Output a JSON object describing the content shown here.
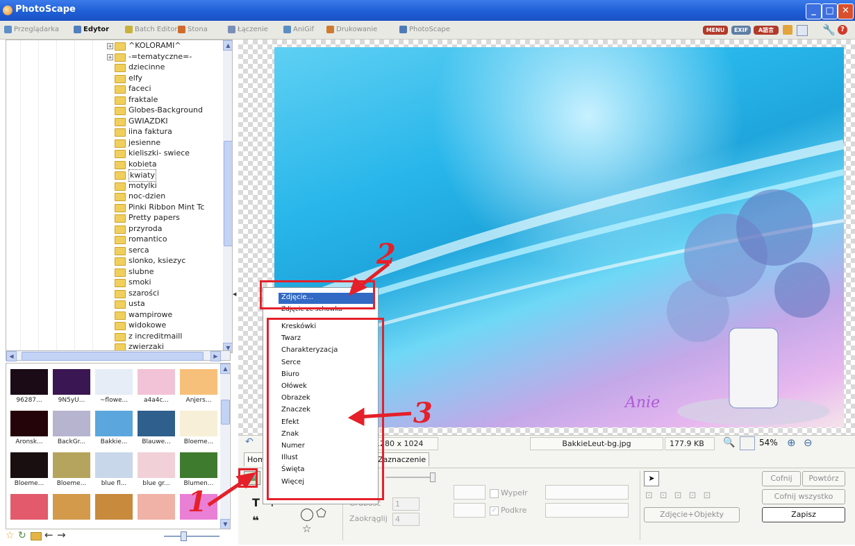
{
  "window": {
    "title": "PhotoScape"
  },
  "tabs": [
    {
      "label": "Przeglądarka",
      "active": false
    },
    {
      "label": "Edytor",
      "active": true
    },
    {
      "label": "Batch Editor",
      "active": false
    },
    {
      "label": "Stona",
      "active": false
    },
    {
      "label": "Łączenie",
      "active": false
    },
    {
      "label": "AniGif",
      "active": false
    },
    {
      "label": "Drukowanie",
      "active": false
    },
    {
      "label": "PhotoScape",
      "active": false
    }
  ],
  "toolbar_right": {
    "menu_label": "MENU",
    "exif_label": "EXIF",
    "lang_label": "A語言"
  },
  "folder_tree": {
    "items": [
      "^KOLORAMI^",
      "-=tematyczne=-",
      "dziecinne",
      "elfy",
      "faceci",
      "fraktale",
      "Globes-Background",
      "GWIAZDKI",
      "iina faktura",
      "jesienne",
      "kieliszki- swiece",
      "kobieta",
      "kwiaty",
      "motylki",
      "noc-dzien",
      "Pinki Ribbon Mint Tc",
      "Pretty papers",
      "przyroda",
      "romantico",
      "serca",
      "slonko, ksiezyc",
      "slubne",
      "smoki",
      "szarości",
      "usta",
      "wampirowe",
      "widokowe",
      "z increditmaill",
      "zwierzaki"
    ],
    "selected": "kwiaty"
  },
  "thumbnails": [
    {
      "label": "96287...",
      "color": "#1a0b16"
    },
    {
      "label": "9N5yU...",
      "color": "#3a1652"
    },
    {
      "label": "~flowe...",
      "color": "#e6edf7"
    },
    {
      "label": "a4a4c...",
      "color": "#f2c3d6"
    },
    {
      "label": "Anjers...",
      "color": "#f7c07a"
    },
    {
      "label": "Aronsk...",
      "color": "#250409"
    },
    {
      "label": "BackGr...",
      "color": "#b7b4cf"
    },
    {
      "label": "Bakkie...",
      "color": "#5aa6dd"
    },
    {
      "label": "Blauwe...",
      "color": "#2f5f8c"
    },
    {
      "label": "Bloeme...",
      "color": "#f7efd8"
    },
    {
      "label": "Bloeme...",
      "color": "#1a0f10"
    },
    {
      "label": "Bloeme...",
      "color": "#b5a45d"
    },
    {
      "label": "blue fl...",
      "color": "#c9d7ea"
    },
    {
      "label": "blue gr...",
      "color": "#f2d0d8"
    },
    {
      "label": "Blumen...",
      "color": "#3f7b2e"
    },
    {
      "label": "",
      "color": "#e25a6b"
    },
    {
      "label": "",
      "color": "#d39a4b"
    },
    {
      "label": "",
      "color": "#c88a3d"
    },
    {
      "label": "",
      "color": "#f0b1a6"
    },
    {
      "label": "",
      "color": "#ea7fd6"
    }
  ],
  "status": {
    "dimensions": "1280 x 1024",
    "filename": "BakkieLeut-bg.jpg",
    "filesize": "177.9 KB",
    "zoom": "54%"
  },
  "edit_tabs": [
    "Hom",
    "Zaznaczenie"
  ],
  "object_panel": {
    "grubosc_label": "Grubość",
    "grubosc_value": "1",
    "zaokraglij_label": "Zaokrąglij",
    "zaokraglij_value": "4",
    "wypelnij_label": "Wypełr",
    "podkreslenie_label": "Podkre",
    "photo_objects_button": "Zdjęcie+Objekty"
  },
  "right_buttons": {
    "undo": "Cofnij",
    "redo": "Powtórz",
    "undo_all": "Cofnij wszystko",
    "save": "Zapisz"
  },
  "context_menu": {
    "top_items": [
      "Zdjęcie...",
      "Zdjęcie ze schowka"
    ],
    "items": [
      "Kreskówki",
      "Twarz",
      "Charakteryzacja",
      "Serce",
      "Biuro",
      "Ołówek",
      "Obrazek",
      "Znaczek",
      "Efekt",
      "Znak",
      "Numer",
      "Illust",
      "Święta",
      "Więcej"
    ]
  },
  "photo": {
    "signature": "Anie"
  },
  "annotations": {
    "one": "1",
    "two": "2",
    "three": "3"
  }
}
